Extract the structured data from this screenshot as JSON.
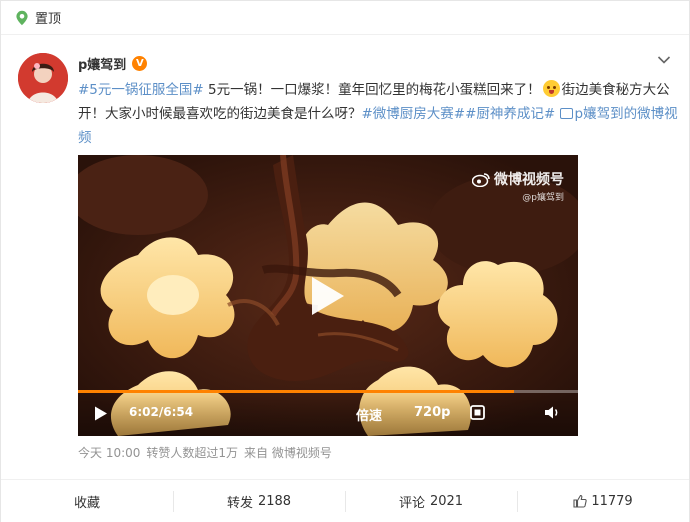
{
  "pinned": {
    "label": "置顶"
  },
  "author": {
    "name": "p孃驾到",
    "verified_badge": "V"
  },
  "post": {
    "segments": [
      {
        "text": "#5元一锅征服全国#",
        "type": "link"
      },
      {
        "text": " 5元一锅！一口爆浆！童年回忆里的梅花小蛋糕回来了！",
        "type": "text"
      },
      {
        "text": "",
        "type": "emoji",
        "icon": "surprised-face-emoji"
      },
      {
        "text": "街边美食秘方大公开！大家小时候最喜欢吃的街边美食是什么呀？",
        "type": "text"
      },
      {
        "text": "#微博厨房大赛#",
        "type": "link"
      },
      {
        "text": "#厨神养成记#",
        "type": "link"
      },
      {
        "text": " ",
        "type": "text"
      },
      {
        "text": "",
        "type": "video-link-icon"
      },
      {
        "text": "p孃驾到的微博视频",
        "type": "link"
      }
    ]
  },
  "video": {
    "watermark": "微博视频号",
    "watermark_handle": "@p孃驾到",
    "time": "6:02/6:54",
    "progress": 0.872,
    "speed_label": "倍速",
    "quality_label": "720p"
  },
  "meta": {
    "time": "今天 10:00",
    "reposts_note": "转赞人数超过1万",
    "source": "来自 微博视频号"
  },
  "actions": {
    "favorite_label": "收藏",
    "repost_label": "转发",
    "repost_count": "2188",
    "comment_label": "评论",
    "comment_count": "2021",
    "like_count": "11779"
  },
  "colors": {
    "link": "#5c8fc7",
    "accent": "#ff8200",
    "pin": "#5fb35f"
  }
}
